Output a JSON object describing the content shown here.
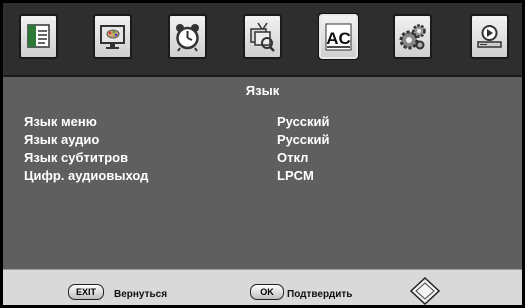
{
  "menu": {
    "title": "Язык",
    "icons": [
      "picture-menu-icon",
      "display-setup-icon",
      "clock-icon",
      "tv-channel-icon",
      "language-icon",
      "settings-gears-icon",
      "media-player-icon"
    ],
    "active_icon": "language-icon",
    "rows": [
      {
        "label": "Язык меню",
        "value": "Русский"
      },
      {
        "label": "Язык аудио",
        "value": "Русский"
      },
      {
        "label": "Язык субтитров",
        "value": "Откл"
      },
      {
        "label": "Цифр. аудиовыход",
        "value": "LPCM"
      }
    ]
  },
  "footer": {
    "exit_key": "EXIT",
    "exit_label": "Вернуться",
    "ok_key": "OK",
    "ok_label": "Подтвердить"
  }
}
